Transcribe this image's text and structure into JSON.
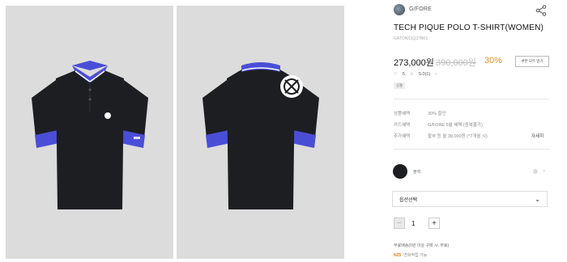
{
  "brand": {
    "name": "G/FORE"
  },
  "product": {
    "title": "TECH PIQUE POLO T-SHIRT(WOMEN)",
    "code": "GATONS1Q37BK1",
    "price": "273,000원",
    "original_price": "390,000원",
    "discount": "30%",
    "coupon_label": "쿠폰 모두 받기",
    "likes": "5",
    "rating": "5.0(1)",
    "tag": "공통"
  },
  "benefits": [
    {
      "label": "상품혜택",
      "value": "30% 할인"
    },
    {
      "label": "카드혜택",
      "value": "G/FORE 5월 혜택 (중복불가)"
    },
    {
      "label": "추가혜택",
      "value": "할부 등 월 39,000원 (*7개월 시)"
    }
  ],
  "detail_link": "자세히",
  "color_option": {
    "label": "블랙",
    "swatch_color": "#1d1e22"
  },
  "option_select": {
    "label": "옵션선택"
  },
  "quantity": {
    "value": "1",
    "minus": "−",
    "plus": "+"
  },
  "shipping_text": "무료배송(0원 이상 구매 시, 무료)",
  "naver_pay": {
    "badge": "N25",
    "text": "연회적립 가능"
  },
  "colors": {
    "shirt": "#1d1e22",
    "accent": "#4a4ed6",
    "photo_bg": "#dcdcdc",
    "discount": "#e0932a"
  }
}
